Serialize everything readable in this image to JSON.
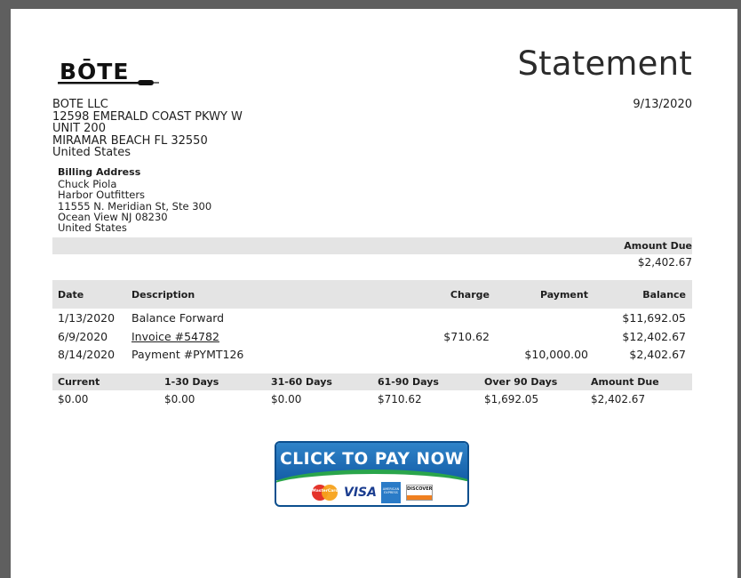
{
  "logo": {
    "text": "BŌTE"
  },
  "header": {
    "title": "Statement",
    "date": "9/13/2020"
  },
  "company": {
    "name": "BOTE LLC",
    "address1": "12598 EMERALD COAST PKWY W",
    "address2": "UNIT 200",
    "city_state_zip": "MIRAMAR BEACH FL 32550",
    "country": "United States"
  },
  "billing": {
    "label": "Billing Address",
    "name": "Chuck Piola",
    "company": "Harbor Outfitters",
    "street": "11555 N. Meridian St, Ste 300",
    "city_state_zip": "Ocean View NJ 08230",
    "country": "United States"
  },
  "amount_due": {
    "label": "Amount Due",
    "value": "$2,402.67"
  },
  "transactions": {
    "headers": {
      "date": "Date",
      "description": "Description",
      "charge": "Charge",
      "payment": "Payment",
      "balance": "Balance"
    },
    "rows": [
      {
        "date": "1/13/2020",
        "description": "Balance Forward",
        "charge": "",
        "payment": "",
        "balance": "$11,692.05"
      },
      {
        "date": "6/9/2020",
        "description": "Invoice #54782",
        "charge": "$710.62",
        "payment": "",
        "balance": "$12,402.67"
      },
      {
        "date": "8/14/2020",
        "description": "Payment #PYMT126",
        "charge": "",
        "payment": "$10,000.00",
        "balance": "$2,402.67"
      }
    ]
  },
  "aging": {
    "headers": [
      "Current",
      "1-30 Days",
      "31-60 Days",
      "61-90 Days",
      "Over 90 Days",
      "Amount Due"
    ],
    "values": [
      "$0.00",
      "$0.00",
      "$0.00",
      "$710.62",
      "$1,692.05",
      "$2,402.67"
    ]
  },
  "pay_button": {
    "label": "CLICK TO PAY NOW",
    "cards": {
      "mastercard": "MasterCard",
      "visa": "VISA",
      "amex": "AMERICAN EXPRESS",
      "discover": "DISCOVER"
    },
    "colors": {
      "blue": "#145ea8",
      "green": "#2aa54b"
    }
  }
}
